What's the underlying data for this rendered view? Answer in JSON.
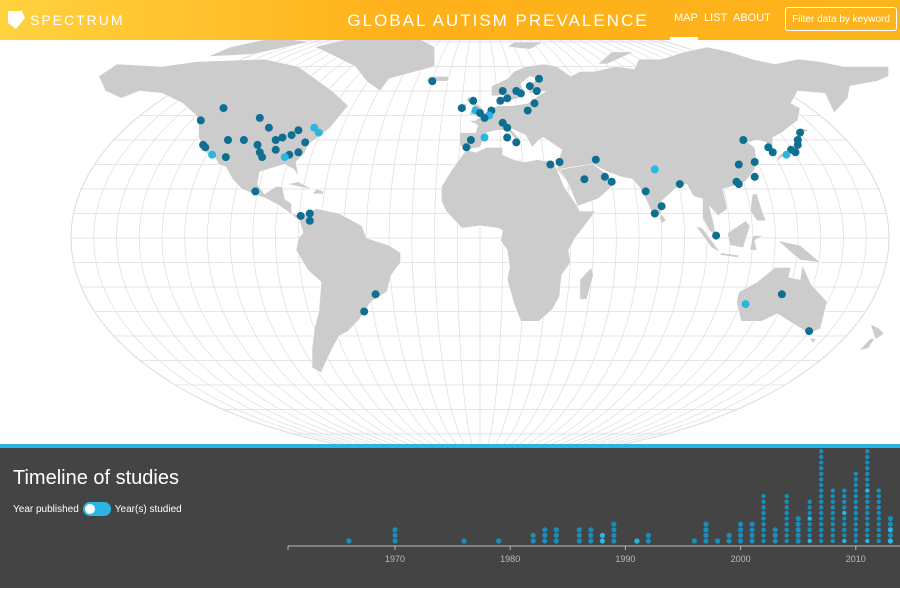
{
  "header": {
    "logo_text": "SPECTRUM",
    "title": "GLOBAL AUTISM PREVALENCE",
    "nav": {
      "map": "MAP",
      "list": "LIST",
      "about": "ABOUT",
      "active": "MAP"
    },
    "filter_placeholder": "Filter data by keyword"
  },
  "map": {
    "colors": {
      "ocean": "#ffffff",
      "land": "#cccccc",
      "graticule": "#dddddd",
      "dot_dark": "#0f6f92",
      "dot_light": "#29b6e3"
    },
    "studies": [
      {
        "lat": 48,
        "lon": -123,
        "c": "d"
      },
      {
        "lat": 53,
        "lon": -113,
        "c": "d"
      },
      {
        "lat": 49,
        "lon": -97,
        "c": "d"
      },
      {
        "lat": 44,
        "lon": -80,
        "c": "d"
      },
      {
        "lat": 45,
        "lon": -73,
        "c": "l"
      },
      {
        "lat": 43,
        "lon": -71,
        "c": "l"
      },
      {
        "lat": 38,
        "lon": -122,
        "c": "d"
      },
      {
        "lat": 37,
        "lon": -121,
        "c": "d"
      },
      {
        "lat": 34,
        "lon": -118,
        "c": "l"
      },
      {
        "lat": 40,
        "lon": -111,
        "c": "d"
      },
      {
        "lat": 40,
        "lon": -104,
        "c": "d"
      },
      {
        "lat": 41,
        "lon": -87,
        "c": "d"
      },
      {
        "lat": 42,
        "lon": -83,
        "c": "d"
      },
      {
        "lat": 39,
        "lon": -77,
        "c": "d"
      },
      {
        "lat": 40,
        "lon": -90,
        "c": "d"
      },
      {
        "lat": 35,
        "lon": -97,
        "c": "d"
      },
      {
        "lat": 36,
        "lon": -90,
        "c": "d"
      },
      {
        "lat": 34,
        "lon": -84,
        "c": "d"
      },
      {
        "lat": 35,
        "lon": -80,
        "c": "d"
      },
      {
        "lat": 33,
        "lon": -96,
        "c": "d"
      },
      {
        "lat": 33,
        "lon": -86,
        "c": "l"
      },
      {
        "lat": 33,
        "lon": -112,
        "c": "d"
      },
      {
        "lat": 19,
        "lon": -99,
        "c": "d"
      },
      {
        "lat": 9,
        "lon": -79,
        "c": "d"
      },
      {
        "lat": 10,
        "lon": -75,
        "c": "d"
      },
      {
        "lat": 7,
        "lon": -75,
        "c": "d"
      },
      {
        "lat": -23,
        "lon": -46,
        "c": "d"
      },
      {
        "lat": -30,
        "lon": -51,
        "c": "d"
      },
      {
        "lat": 64,
        "lon": -21,
        "c": "d"
      },
      {
        "lat": 60,
        "lon": 10,
        "c": "d"
      },
      {
        "lat": 60,
        "lon": 16,
        "c": "d"
      },
      {
        "lat": 59,
        "lon": 18,
        "c": "d"
      },
      {
        "lat": 57,
        "lon": 12,
        "c": "d"
      },
      {
        "lat": 56,
        "lon": 9,
        "c": "d"
      },
      {
        "lat": 56,
        "lon": -3,
        "c": "d"
      },
      {
        "lat": 53,
        "lon": -8,
        "c": "d"
      },
      {
        "lat": 52,
        "lon": -2,
        "c": "l"
      },
      {
        "lat": 51,
        "lon": 0,
        "c": "d"
      },
      {
        "lat": 52,
        "lon": 5,
        "c": "d"
      },
      {
        "lat": 50,
        "lon": 4,
        "c": "l"
      },
      {
        "lat": 49,
        "lon": 2,
        "c": "d"
      },
      {
        "lat": 47,
        "lon": 10,
        "c": "d"
      },
      {
        "lat": 45,
        "lon": 12,
        "c": "d"
      },
      {
        "lat": 52,
        "lon": 21,
        "c": "d"
      },
      {
        "lat": 60,
        "lon": 25,
        "c": "d"
      },
      {
        "lat": 65,
        "lon": 26,
        "c": "d"
      },
      {
        "lat": 62,
        "lon": 22,
        "c": "d"
      },
      {
        "lat": 55,
        "lon": 24,
        "c": "d"
      },
      {
        "lat": 40,
        "lon": -4,
        "c": "d"
      },
      {
        "lat": 41,
        "lon": 2,
        "c": "l"
      },
      {
        "lat": 37,
        "lon": -6,
        "c": "d"
      },
      {
        "lat": 41,
        "lon": 12,
        "c": "d"
      },
      {
        "lat": 39,
        "lon": 16,
        "c": "d"
      },
      {
        "lat": 31,
        "lon": 35,
        "c": "d"
      },
      {
        "lat": 30,
        "lon": 31,
        "c": "d"
      },
      {
        "lat": 32,
        "lon": 51,
        "c": "d"
      },
      {
        "lat": 24,
        "lon": 46,
        "c": "d"
      },
      {
        "lat": 23,
        "lon": 58,
        "c": "d"
      },
      {
        "lat": 25,
        "lon": 55,
        "c": "d"
      },
      {
        "lat": 28,
        "lon": 77,
        "c": "l"
      },
      {
        "lat": 19,
        "lon": 73,
        "c": "d"
      },
      {
        "lat": 22,
        "lon": 88,
        "c": "d"
      },
      {
        "lat": 10,
        "lon": 77,
        "c": "d"
      },
      {
        "lat": 13,
        "lon": 80,
        "c": "d"
      },
      {
        "lat": 40,
        "lon": 116,
        "c": "d"
      },
      {
        "lat": 31,
        "lon": 121,
        "c": "d"
      },
      {
        "lat": 30,
        "lon": 114,
        "c": "d"
      },
      {
        "lat": 23,
        "lon": 113,
        "c": "d"
      },
      {
        "lat": 22,
        "lon": 114,
        "c": "d"
      },
      {
        "lat": 25,
        "lon": 121,
        "c": "d"
      },
      {
        "lat": 37,
        "lon": 127,
        "c": "d"
      },
      {
        "lat": 35,
        "lon": 129,
        "c": "d"
      },
      {
        "lat": 36,
        "lon": 137,
        "c": "d"
      },
      {
        "lat": 35,
        "lon": 139,
        "c": "d"
      },
      {
        "lat": 34,
        "lon": 135,
        "c": "l"
      },
      {
        "lat": 38,
        "lon": 140,
        "c": "d"
      },
      {
        "lat": 43,
        "lon": 141,
        "c": "d"
      },
      {
        "lat": 40,
        "lon": 140,
        "c": "d"
      },
      {
        "lat": 1,
        "lon": 104,
        "c": "d"
      },
      {
        "lat": -23,
        "lon": 133,
        "c": "d"
      },
      {
        "lat": -27,
        "lon": 117,
        "c": "l"
      },
      {
        "lat": -38,
        "lon": 145,
        "c": "d"
      },
      {
        "lat": 45,
        "lon": -93,
        "c": "d"
      },
      {
        "lat": 38,
        "lon": -98,
        "c": "d"
      }
    ]
  },
  "timeline": {
    "title": "Timeline of studies",
    "toggle_left": "Year published",
    "toggle_right": "Year(s) studied",
    "chart_data": {
      "type": "scatter",
      "xlim": [
        1950,
        2014
      ],
      "ticks": [
        "1970",
        "1980",
        "1990",
        "2000",
        "2010"
      ],
      "tick_values": [
        1970,
        1980,
        1990,
        2000,
        2010
      ],
      "stacks": [
        {
          "year": 1966,
          "n": 1,
          "hi": 0
        },
        {
          "year": 1970,
          "n": 3,
          "hi": 0
        },
        {
          "year": 1976,
          "n": 1,
          "hi": 0
        },
        {
          "year": 1979,
          "n": 1,
          "hi": 0
        },
        {
          "year": 1982,
          "n": 2,
          "hi": 0
        },
        {
          "year": 1983,
          "n": 3,
          "hi": 0
        },
        {
          "year": 1984,
          "n": 3,
          "hi": 0
        },
        {
          "year": 1986,
          "n": 3,
          "hi": 0
        },
        {
          "year": 1987,
          "n": 3,
          "hi": 0
        },
        {
          "year": 1988,
          "n": 2,
          "hi": 1
        },
        {
          "year": 1989,
          "n": 4,
          "hi": 0
        },
        {
          "year": 1991,
          "n": 1,
          "hi": 1
        },
        {
          "year": 1992,
          "n": 2,
          "hi": 0
        },
        {
          "year": 1996,
          "n": 1,
          "hi": 0
        },
        {
          "year": 1997,
          "n": 4,
          "hi": 0
        },
        {
          "year": 1998,
          "n": 1,
          "hi": 0
        },
        {
          "year": 1999,
          "n": 2,
          "hi": 0
        },
        {
          "year": 2000,
          "n": 4,
          "hi": 0
        },
        {
          "year": 2001,
          "n": 4,
          "hi": 0
        },
        {
          "year": 2002,
          "n": 9,
          "hi": 0
        },
        {
          "year": 2003,
          "n": 3,
          "hi": 0
        },
        {
          "year": 2004,
          "n": 9,
          "hi": 0
        },
        {
          "year": 2005,
          "n": 5,
          "hi": 0
        },
        {
          "year": 2006,
          "n": 8,
          "hi": 1
        },
        {
          "year": 2007,
          "n": 17,
          "hi": 0
        },
        {
          "year": 2008,
          "n": 10,
          "hi": 0
        },
        {
          "year": 2009,
          "n": 10,
          "hi": 1
        },
        {
          "year": 2010,
          "n": 13,
          "hi": 0
        },
        {
          "year": 2011,
          "n": 18,
          "hi": 1
        },
        {
          "year": 2012,
          "n": 10,
          "hi": 0
        },
        {
          "year": 2013,
          "n": 5,
          "hi": 1
        }
      ]
    }
  }
}
